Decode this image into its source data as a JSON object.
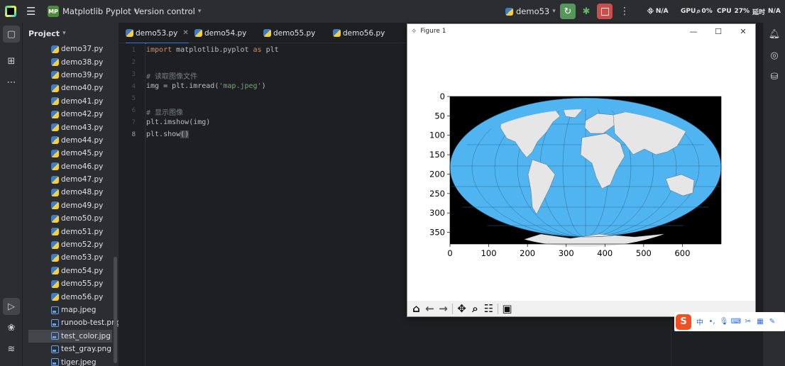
{
  "titlebar": {
    "project_badge": "MP",
    "project_name": "Matplotlib Pyplot",
    "vcs": "Version control",
    "run_config": "demo53",
    "net_label": "N/A",
    "gpu_label": "GPU",
    "gpu_value": "0%",
    "cpu_label": "CPU",
    "cpu_value": "27%",
    "latency_label": "延时",
    "latency_value": "N/A",
    "icons": [
      "app-logo-icon",
      "hamburger-icon",
      "run-icon",
      "debug-icon",
      "stop-icon",
      "more-vertical-icon",
      "search-icon"
    ],
    "colors": {
      "run": "#57965c",
      "stop": "#c94f4f",
      "badge": "#4e8a3b"
    }
  },
  "project_panel": {
    "header": "Project",
    "files": [
      {
        "name": "demo37.py",
        "type": "py"
      },
      {
        "name": "demo38.py",
        "type": "py"
      },
      {
        "name": "demo39.py",
        "type": "py"
      },
      {
        "name": "demo40.py",
        "type": "py"
      },
      {
        "name": "demo41.py",
        "type": "py"
      },
      {
        "name": "demo42.py",
        "type": "py"
      },
      {
        "name": "demo43.py",
        "type": "py"
      },
      {
        "name": "demo44.py",
        "type": "py"
      },
      {
        "name": "demo45.py",
        "type": "py"
      },
      {
        "name": "demo46.py",
        "type": "py"
      },
      {
        "name": "demo47.py",
        "type": "py"
      },
      {
        "name": "demo48.py",
        "type": "py"
      },
      {
        "name": "demo49.py",
        "type": "py"
      },
      {
        "name": "demo50.py",
        "type": "py"
      },
      {
        "name": "demo51.py",
        "type": "py"
      },
      {
        "name": "demo52.py",
        "type": "py"
      },
      {
        "name": "demo53.py",
        "type": "py"
      },
      {
        "name": "demo54.py",
        "type": "py"
      },
      {
        "name": "demo55.py",
        "type": "py"
      },
      {
        "name": "demo56.py",
        "type": "py"
      },
      {
        "name": "map.jpeg",
        "type": "img"
      },
      {
        "name": "runoob-test.png",
        "type": "img"
      },
      {
        "name": "test_color.jpg",
        "type": "img",
        "selected": true
      },
      {
        "name": "test_gray.png",
        "type": "img"
      },
      {
        "name": "tiger.jpeg",
        "type": "img"
      }
    ]
  },
  "editor": {
    "tabs": [
      {
        "label": "demo53.py",
        "active": true
      },
      {
        "label": "demo54.py"
      },
      {
        "label": "demo55.py"
      },
      {
        "label": "demo56.py"
      }
    ],
    "current_line": 8,
    "lines": [
      {
        "no": "1",
        "tokens": [
          {
            "t": "import",
            "c": "kw"
          },
          {
            "t": " matplotlib.pyplot "
          },
          {
            "t": "as",
            "c": "kw"
          },
          {
            "t": " plt"
          }
        ]
      },
      {
        "no": "2",
        "tokens": []
      },
      {
        "no": "3",
        "tokens": [
          {
            "t": "# 读取图像文件",
            "c": "cm"
          }
        ]
      },
      {
        "no": "4",
        "tokens": [
          {
            "t": "img = plt.imread("
          },
          {
            "t": "'map.jpeg'",
            "c": "st"
          },
          {
            "t": ")"
          }
        ]
      },
      {
        "no": "5",
        "tokens": []
      },
      {
        "no": "6",
        "tokens": [
          {
            "t": "# 显示图像",
            "c": "cm"
          }
        ]
      },
      {
        "no": "7",
        "tokens": [
          {
            "t": "plt.imshow(img)"
          }
        ]
      },
      {
        "no": "8",
        "tokens": [
          {
            "t": "plt.show"
          },
          {
            "t": "()",
            "c": "paren-hl"
          }
        ]
      }
    ]
  },
  "figure": {
    "title": "Figure 1",
    "controls": [
      "minimize-icon",
      "maximize-icon",
      "close-icon"
    ],
    "x_ticks": [
      "0",
      "100",
      "200",
      "300",
      "400",
      "500",
      "600"
    ],
    "y_ticks": [
      "0",
      "50",
      "100",
      "150",
      "200",
      "250",
      "300",
      "350"
    ],
    "toolbar_icons": [
      "home-icon",
      "back-icon",
      "forward-icon",
      "pan-icon",
      "zoom-icon",
      "configure-subplots-icon",
      "save-icon"
    ],
    "colors": {
      "ocean": "#4fb4f0",
      "land": "#e6e6e6",
      "background": "#000000"
    }
  },
  "ime": {
    "logo": "S",
    "mode": "中",
    "items": [
      "punctuation-icon",
      "microphone-icon",
      "keyboard-icon",
      "skin-icon",
      "grid-icon",
      "tools-icon"
    ]
  }
}
